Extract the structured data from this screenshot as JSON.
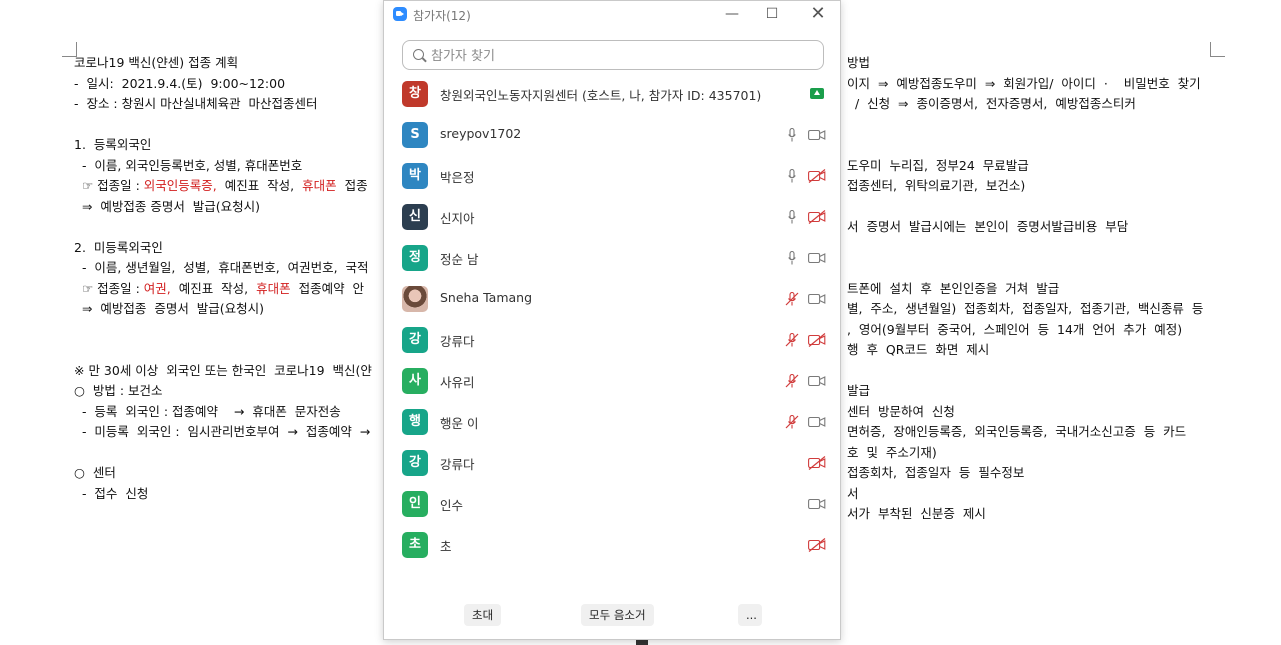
{
  "document": {
    "left_lines": [
      {
        "text": "코로나19 백신(얀센) 접종 계획"
      },
      {
        "text": "-  일시:  2021.9.4.(토)  9:00~12:00"
      },
      {
        "text": "-  장소 : 창원시 마산실내체육관  마산접종센터"
      },
      {
        "text": ""
      },
      {
        "text": "1.  등록외국인"
      },
      {
        "text": "  -  이름, 외국인등록번호, 성별, 휴대폰번호"
      },
      {
        "text": "  ☞ 접종일 : 외국인등록증,  예진표  작성,  휴대폰  접종"
      },
      {
        "text": "  ⇒  예방접종 증명서  발급(요청시)"
      },
      {
        "text": ""
      },
      {
        "text": "2.  미등록외국인"
      },
      {
        "text": "  -  이름, 생년월일,  성별,  휴대폰번호,  여권번호,  국적"
      },
      {
        "text": "  ☞ 접종일 : 여권,  예진표  작성,  휴대폰  접종예약  안"
      },
      {
        "text": "  ⇒  예방접종  증명서  발급(요청시)"
      },
      {
        "text": ""
      },
      {
        "text": ""
      },
      {
        "text": "※ 만 30세 이상  외국인 또는 한국인  코로나19  백신(얀"
      },
      {
        "text": "○  방법 : 보건소"
      },
      {
        "text": "  -  등록  외국인 : 접종예약    →  휴대폰  문자전송"
      },
      {
        "text": "  -  미등록  외국인 :  임시관리번호부여  →  접종예약  →"
      },
      {
        "text": ""
      },
      {
        "text": "○  센터"
      },
      {
        "text": "  -  접수  신청"
      }
    ],
    "right_lines": [
      {
        "text": "방법"
      },
      {
        "text": "이지  ⇒  예방접종도우미  ⇒  회원가입/  아이디  ·    비밀번호  찾기"
      },
      {
        "text": "  /  신청  ⇒  종이증명서,  전자증명서,  예방접종스티커"
      },
      {
        "text": ""
      },
      {
        "text": ""
      },
      {
        "text": "도우미  누리집,  정부24  무료발급"
      },
      {
        "text": "접종센터,  위탁의료기관,  보건소)"
      },
      {
        "text": ""
      },
      {
        "text": "서  증명서  발급시에는  본인이  증명서발급비용  부담"
      },
      {
        "text": ""
      },
      {
        "text": ""
      },
      {
        "text": "트폰에  설치  후  본인인증을  거쳐  발급"
      },
      {
        "text": "별,  주소,  생년월일)  접종회차,  접종일자,  접종기관,  백신종류  등"
      },
      {
        "text": ",  영어(9월부터  중국어,  스페인어  등  14개  언어  추가  예정)"
      },
      {
        "text": "행  후  QR코드  화면  제시"
      },
      {
        "text": ""
      },
      {
        "text": "발급"
      },
      {
        "text": "센터  방문하여  신청"
      },
      {
        "text": "면허증,  장애인등록증,  외국인등록증,  국내거소신고증  등  카드"
      },
      {
        "text": "호  및  주소기재)"
      },
      {
        "text": "접종회차,  접종일자  등  필수정보"
      },
      {
        "text": "서"
      },
      {
        "text": "서가  부착된  신분증  제시"
      }
    ]
  },
  "window": {
    "title": "참가자(12)",
    "search_placeholder": "참가자 찾기",
    "participants": [
      {
        "initial": "창",
        "color": "#c0392b",
        "name": "창원외국인노동자지원센터 (호스트, 나, 참가자",
        "suffix": " ID: 435701)",
        "mic": "none",
        "cam": "none",
        "share": true
      },
      {
        "initial": "S",
        "color": "#2e86c1",
        "name": "sreypov1702",
        "mic": "on",
        "cam": "on",
        "share": false
      },
      {
        "initial": "박",
        "color": "#2e86c1",
        "name": "박은정",
        "mic": "on",
        "cam": "off",
        "share": false
      },
      {
        "initial": "신",
        "color": "#2c3e50",
        "name": "신지아",
        "mic": "on",
        "cam": "off",
        "share": false
      },
      {
        "initial": "정",
        "color": "#17a589",
        "name": "정순 남",
        "mic": "on",
        "cam": "on",
        "share": false
      },
      {
        "initial": "",
        "color": "#d5b6a8",
        "photo": true,
        "name": "Sneha Tamang",
        "mic": "muted",
        "cam": "on",
        "share": false
      },
      {
        "initial": "강",
        "color": "#17a589",
        "name": "강류다",
        "mic": "muted",
        "cam": "off",
        "share": false
      },
      {
        "initial": "사",
        "color": "#27ae60",
        "name": "사유리",
        "mic": "muted",
        "cam": "on",
        "share": false
      },
      {
        "initial": "행",
        "color": "#17a589",
        "name": "행운 이",
        "mic": "muted",
        "cam": "on",
        "share": false
      },
      {
        "initial": "강",
        "color": "#17a589",
        "name": "강류다",
        "mic": "none",
        "cam": "off",
        "share": false
      },
      {
        "initial": "인",
        "color": "#27ae60",
        "name": "인수",
        "mic": "none",
        "cam": "on",
        "share": false
      },
      {
        "initial": "초",
        "color": "#27ae60",
        "name": "초",
        "mic": "none",
        "cam": "off",
        "share": false
      }
    ],
    "footer": {
      "invite_label": "초대",
      "mute_all_label": "모두 음소거",
      "more_label": "..."
    }
  }
}
